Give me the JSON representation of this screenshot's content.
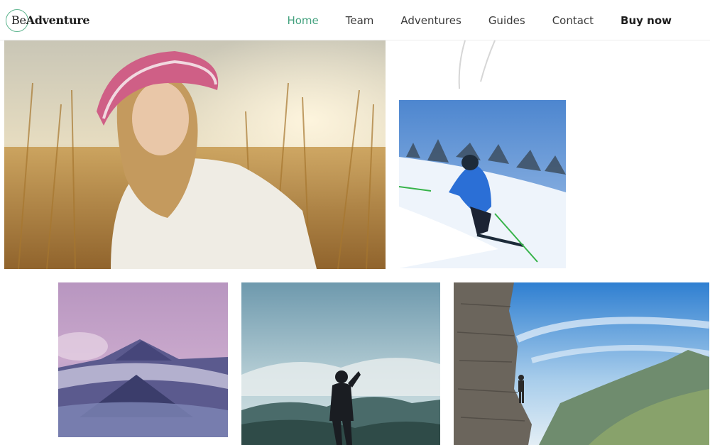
{
  "brand": {
    "prefix": "Be",
    "name": "Adventure",
    "accent": "#5fb58f"
  },
  "nav": {
    "items": [
      {
        "label": "Home",
        "active": true
      },
      {
        "label": "Team",
        "active": false
      },
      {
        "label": "Adventures",
        "active": false
      },
      {
        "label": "Guides",
        "active": false
      },
      {
        "label": "Contact",
        "active": false
      }
    ],
    "cta": "Buy now"
  },
  "gallery": [
    {
      "subject": "woman-in-wheat-field"
    },
    {
      "subject": "skier-on-slope"
    },
    {
      "subject": "volcano-at-dusk"
    },
    {
      "subject": "hiker-on-ridge"
    },
    {
      "subject": "climber-on-cliff"
    }
  ],
  "colors": {
    "active_nav": "#44a27f",
    "text": "#3a3a3a"
  }
}
